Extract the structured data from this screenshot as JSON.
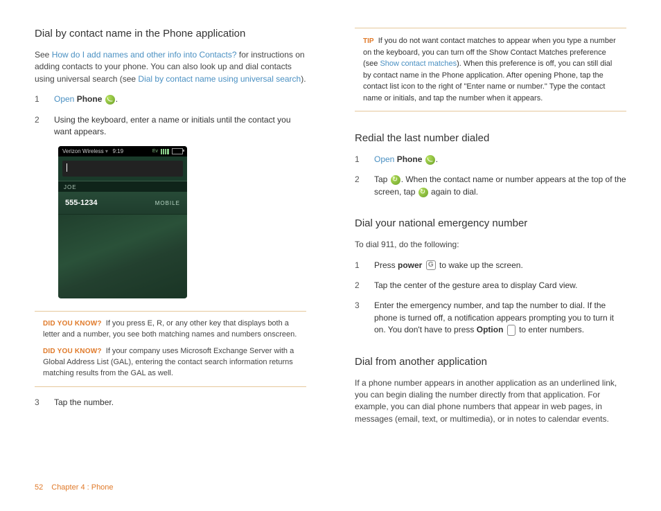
{
  "left": {
    "h1": "Dial by contact name in the Phone application",
    "intro_a": "See ",
    "intro_link1": "How do I add names and other info into Contacts?",
    "intro_b": " for instructions on adding contacts to your phone. You can also look up and dial contacts using universal search (see ",
    "intro_link2": "Dial by contact name using universal search",
    "intro_c": ").",
    "steps": {
      "s1_num": "1",
      "s1_open": "Open",
      "s1_phone": "Phone",
      "s1_dot": ".",
      "s2_num": "2",
      "s2_text": "Using the keyboard, enter a name or initials until the contact you want appears.",
      "s3_num": "3",
      "s3_text": "Tap the number."
    },
    "screenshot": {
      "carrier": "Verizon Wireless",
      "time": "9:19",
      "label": "JOE",
      "number": "555-1234",
      "type": "MOBILE"
    },
    "note1_label": "DID YOU KNOW?",
    "note1_text": "If you press E, R, or any other key that displays both a letter and a number, you see both matching names and numbers onscreen.",
    "note2_label": "DID YOU KNOW?",
    "note2_text": "If your company uses Microsoft Exchange Server with a Global Address List (GAL), entering the contact search information returns matching results from the GAL as well."
  },
  "right": {
    "tip_label": "TIP",
    "tip_a": "If you do not want contact matches to appear when you type a number on the keyboard, you can turn off the Show Contact Matches preference (see ",
    "tip_link": "Show contact matches",
    "tip_b": "). When this preference is off, you can still dial by contact name in the Phone application. After opening Phone, tap the contact list icon to the right of \"Enter name or number.\" Type the contact name or initials, and tap the number when it appears.",
    "h_redial": "Redial the last number dialed",
    "redial": {
      "s1_num": "1",
      "s1_open": "Open",
      "s1_phone": "Phone",
      "s1_dot": ".",
      "s2_num": "2",
      "s2_a": "Tap ",
      "s2_b": ". When the contact name or number appears at the top of the screen, tap ",
      "s2_c": " again to dial."
    },
    "h_emerg": "Dial your national emergency number",
    "emerg_intro": "To dial 911, do the following:",
    "emerg": {
      "s1_num": "1",
      "s1_a": "Press ",
      "s1_power": "power",
      "s1_b": " to wake up the screen.",
      "s2_num": "2",
      "s2_text": "Tap the center of the gesture area to display Card view.",
      "s3_num": "3",
      "s3_a": "Enter the emergency number, and tap the number to dial. If the phone is turned off, a notification appears prompting you to turn it on. You don't have to press ",
      "s3_option": "Option",
      "s3_b": " to enter numbers."
    },
    "h_other": "Dial from another application",
    "other_text": "If a phone number appears in another application as an underlined link, you can begin dialing the number directly from that application. For example, you can dial phone numbers that appear in web pages, in messages (email, text, or multimedia), or in notes to calendar events."
  },
  "footer": {
    "page": "52",
    "chapter": "Chapter 4 : Phone"
  }
}
